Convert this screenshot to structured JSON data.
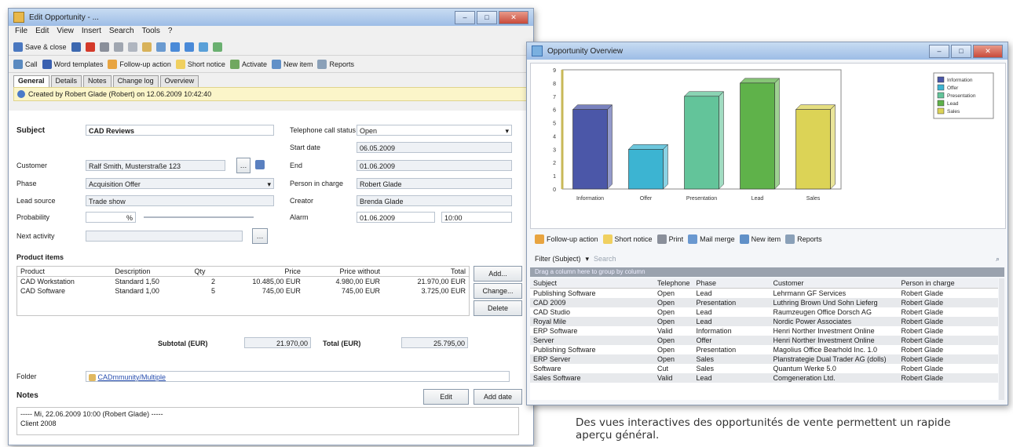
{
  "left_window": {
    "title": "Edit Opportunity - ...",
    "menu": [
      "File",
      "Edit",
      "View",
      "Insert",
      "Search",
      "Tools",
      "?"
    ],
    "toolbar1": {
      "save_label": "Save & close"
    },
    "toolbar2": [
      {
        "label": "Call",
        "icon": "phone-icon"
      },
      {
        "label": "Word templates",
        "icon": "word-icon"
      },
      {
        "label": "Follow-up action",
        "icon": "followup-icon"
      },
      {
        "label": "Short notice",
        "icon": "note-icon"
      },
      {
        "label": "Activate",
        "icon": "activate-icon"
      },
      {
        "label": "New item",
        "icon": "new-item-icon"
      },
      {
        "label": "Reports",
        "icon": "report-icon"
      }
    ],
    "tabs": [
      "General",
      "Details",
      "Notes",
      "Change log",
      "Overview"
    ],
    "info": "Created by Robert Glade (Robert) on 12.06.2009 10:42:40",
    "fields": {
      "subject_label": "Subject",
      "subject": "CAD Reviews",
      "telephone_label": "Telephone call status",
      "telephone": "Open",
      "start_date_label": "Start date",
      "start_date": "06.05.2009",
      "customer_label": "Customer",
      "customer": "Ralf Smith, Musterstraße 123",
      "end_label": "End",
      "end": "01.06.2009",
      "phase_label": "Phase",
      "phase": "Acquisition Offer",
      "person_label": "Person in charge",
      "person": "Robert Glade",
      "lead_source_label": "Lead source",
      "lead_source": "Trade show",
      "creator_label": "Creator",
      "creator": "Brenda Glade",
      "prob_label": "Probability",
      "prob": "%",
      "alarm_label": "Alarm",
      "alarm": "01.06.2009",
      "alarm_time": "10:00",
      "next_activity_label": "Next activity"
    },
    "products": {
      "title": "Product items",
      "headers": [
        "Product",
        "Description",
        "Qty",
        "Price",
        "Price without",
        "Total"
      ],
      "rows": [
        [
          "CAD Workstation",
          "Standard 1,50",
          "2",
          "10.485,00 EUR",
          "4.980,00 EUR",
          "21.970,00 EUR"
        ],
        [
          "CAD Software",
          "Standard 1,00",
          "5",
          "745,00 EUR",
          "745,00 EUR",
          "3.725,00 EUR"
        ]
      ],
      "add": "Add...",
      "change": "Change...",
      "delete": "Delete",
      "subtotal_label": "Subtotal (EUR)",
      "subtotal": "21.970,00",
      "total_label": "Total (EUR)",
      "total": "25.795,00"
    },
    "folder_label": "Folder",
    "folder": "CADmmunity/Multiple",
    "notes_label": "Notes",
    "edit_label": "Edit",
    "add_date_label": "Add date",
    "notes_text1": "----- Mi, 22.06.2009 10:00 (Robert Glade) -----",
    "notes_text2": "Client 2008"
  },
  "right_window": {
    "title": "Opportunity Overview",
    "toolbar": [
      {
        "label": "Follow-up action",
        "icon": "followup-icon"
      },
      {
        "label": "Short notice",
        "icon": "note-icon"
      },
      {
        "label": "Print",
        "icon": "print-icon"
      },
      {
        "label": "Mail merge",
        "icon": "mail-icon"
      },
      {
        "label": "New item",
        "icon": "new-item-icon"
      },
      {
        "label": "Reports",
        "icon": "report-icon"
      }
    ],
    "filter_label": "Filter (Subject)",
    "filter_hint": "Search",
    "group_bar": "Drag a column here to group by column",
    "list_headers": [
      "Subject",
      "Telephone",
      "Phase",
      "Customer",
      "Person in charge"
    ],
    "list_rows": [
      [
        "Publishing Software",
        "Open",
        "Lead",
        "Lehrmann GF Services",
        "Robert Glade"
      ],
      [
        "CAD 2009",
        "Open",
        "Presentation",
        "Luthring Brown Und Sohn Lieferg",
        "Robert Glade"
      ],
      [
        "CAD Studio",
        "Open",
        "Lead",
        "Raumzeugen Office Dorsch AG",
        "Robert Glade"
      ],
      [
        "Royal Mile",
        "Open",
        "Lead",
        "Nordic Power Associates",
        "Robert Glade"
      ],
      [
        "ERP Software",
        "Valid",
        "Information",
        "Henri Norther Investment Online",
        "Robert Glade"
      ],
      [
        "Server",
        "Open",
        "Offer",
        "Henri Norther Investment Online",
        "Robert Glade"
      ],
      [
        "Publishing Software",
        "Open",
        "Presentation",
        "Magolius Office Bearhold Inc. 1.0",
        "Robert Glade"
      ],
      [
        "ERP Server",
        "Open",
        "Sales",
        "Planstrategie Dual Trader AG (dolls)",
        "Robert Glade"
      ],
      [
        "Software",
        "Cut",
        "Sales",
        "Quantum Werke 5.0",
        "Robert Glade"
      ],
      [
        "Sales Software",
        "Valid",
        "Lead",
        "Comgeneration Ltd.",
        "Robert Glade"
      ]
    ]
  },
  "chart_data": {
    "type": "bar",
    "categories": [
      "Information",
      "Offer",
      "Presentation",
      "Lead",
      "Sales"
    ],
    "values": [
      6,
      3,
      7,
      8,
      6
    ],
    "colors": [
      "#4b57a8",
      "#3cb4d2",
      "#63c49a",
      "#5fb24a",
      "#dcd356"
    ],
    "ylim": [
      0,
      9
    ],
    "yticks": [
      "0",
      "1",
      "2",
      "3",
      "4",
      "5",
      "6",
      "7",
      "8",
      "9"
    ],
    "legend": [
      "Information",
      "Offer",
      "Presentation",
      "Lead",
      "Sales"
    ],
    "legend_position": "top-right",
    "grid": false
  },
  "caption": "Des vues interactives des opportunités de vente permettent un rapide aperçu général."
}
